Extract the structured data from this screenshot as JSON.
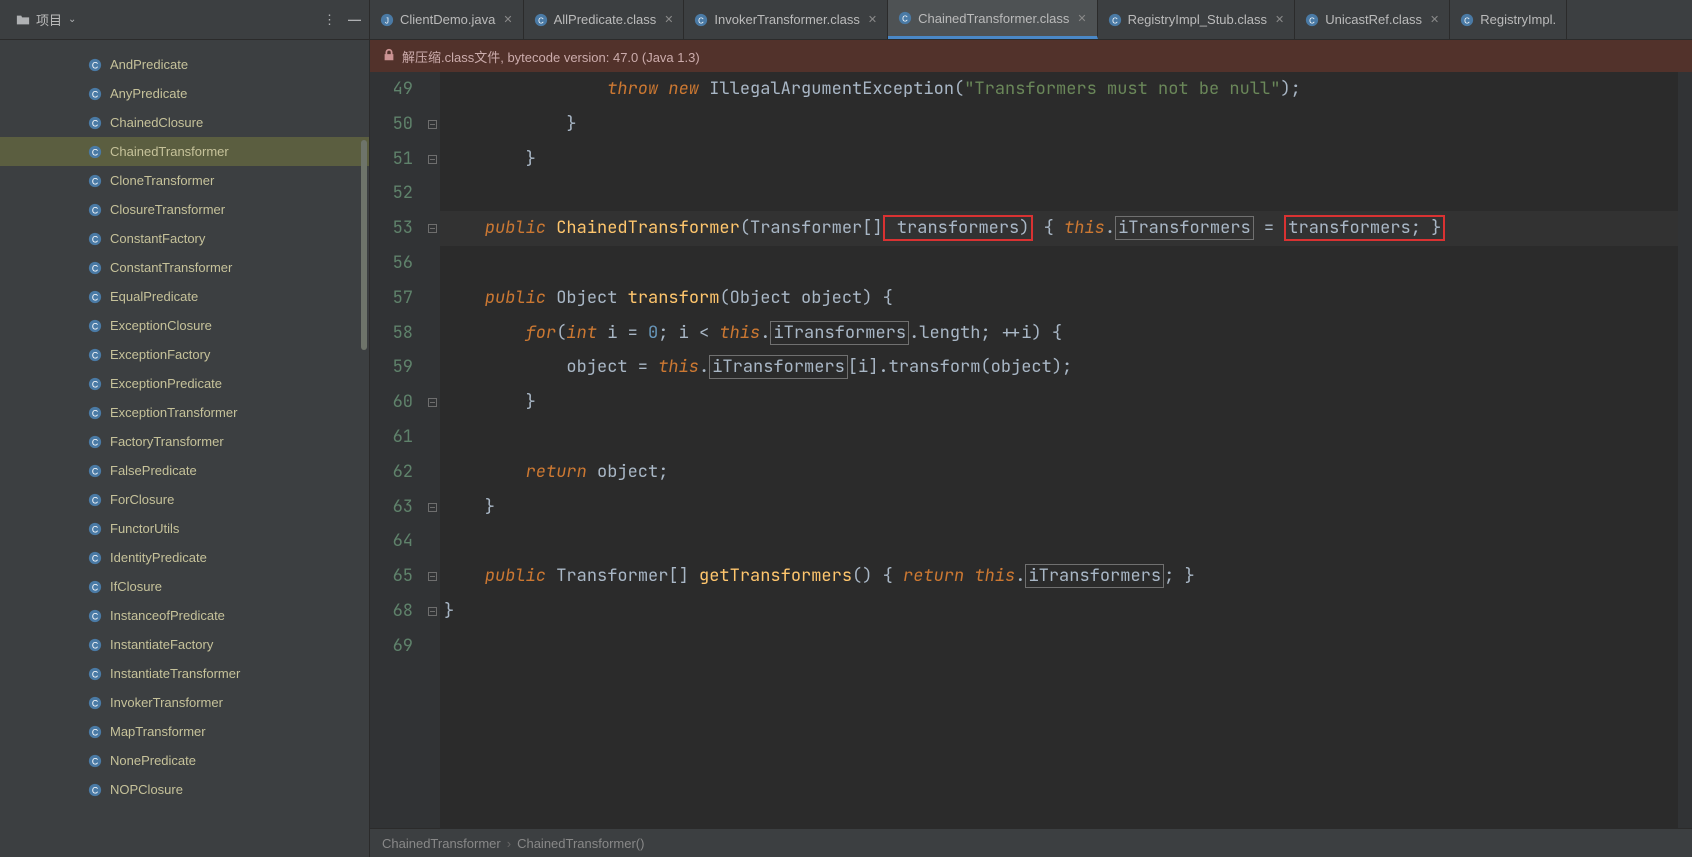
{
  "sidebar": {
    "header_label": "项目",
    "items": [
      "AndPredicate",
      "AnyPredicate",
      "ChainedClosure",
      "ChainedTransformer",
      "CloneTransformer",
      "ClosureTransformer",
      "ConstantFactory",
      "ConstantTransformer",
      "EqualPredicate",
      "ExceptionClosure",
      "ExceptionFactory",
      "ExceptionPredicate",
      "ExceptionTransformer",
      "FactoryTransformer",
      "FalsePredicate",
      "ForClosure",
      "FunctorUtils",
      "IdentityPredicate",
      "IfClosure",
      "InstanceofPredicate",
      "InstantiateFactory",
      "InstantiateTransformer",
      "InvokerTransformer",
      "MapTransformer",
      "NonePredicate",
      "NOPClosure"
    ],
    "selected_index": 3
  },
  "tabs": [
    {
      "label": "ClientDemo.java",
      "type": "java"
    },
    {
      "label": "AllPredicate.class",
      "type": "class"
    },
    {
      "label": "InvokerTransformer.class",
      "type": "class"
    },
    {
      "label": "ChainedTransformer.class",
      "type": "class",
      "active": true
    },
    {
      "label": "RegistryImpl_Stub.class",
      "type": "class"
    },
    {
      "label": "UnicastRef.class",
      "type": "class"
    },
    {
      "label": "RegistryImpl.",
      "type": "class"
    }
  ],
  "banner": {
    "icon": "lock-icon",
    "text": "解压缩.class文件, bytecode version: 47.0 (Java 1.3)"
  },
  "gutter_lines": [
    "49",
    "50",
    "51",
    "52",
    "53",
    "56",
    "57",
    "58",
    "59",
    "60",
    "61",
    "62",
    "63",
    "64",
    "65",
    "68",
    "69",
    ""
  ],
  "code": {
    "l49": {
      "throw": "throw",
      "new": "new",
      "ex": "IllegalArgumentException",
      "s": "\"Transformers must not be null\""
    },
    "l53": {
      "pub": "public",
      "cls": "ChainedTransformer",
      "tp": "Transformer",
      "p": "transformers",
      "this": "this",
      "field": "iTransformers",
      "eq": "=",
      "p2": "transformers"
    },
    "l57": {
      "pub": "public",
      "ret": "Object",
      "m": "transform",
      "at": "Object",
      "an": "object"
    },
    "l58": {
      "for": "for",
      "int": "int",
      "i": "i",
      "z": "0",
      "this": "this",
      "f": "iTransformers",
      "len": ".length",
      "ppi": "++i"
    },
    "l59": {
      "obj": "object",
      "this": "this",
      "f": "iTransformers",
      "i": "i",
      "m": "transform",
      "a": "object"
    },
    "l62": {
      "ret": "return",
      "o": "object"
    },
    "l65": {
      "pub": "public",
      "tp": "Transformer",
      "m": "getTransformers",
      "ret": "return",
      "this": "this",
      "f": "iTransformers"
    }
  },
  "breadcrumb": [
    "ChainedTransformer",
    "ChainedTransformer()"
  ]
}
